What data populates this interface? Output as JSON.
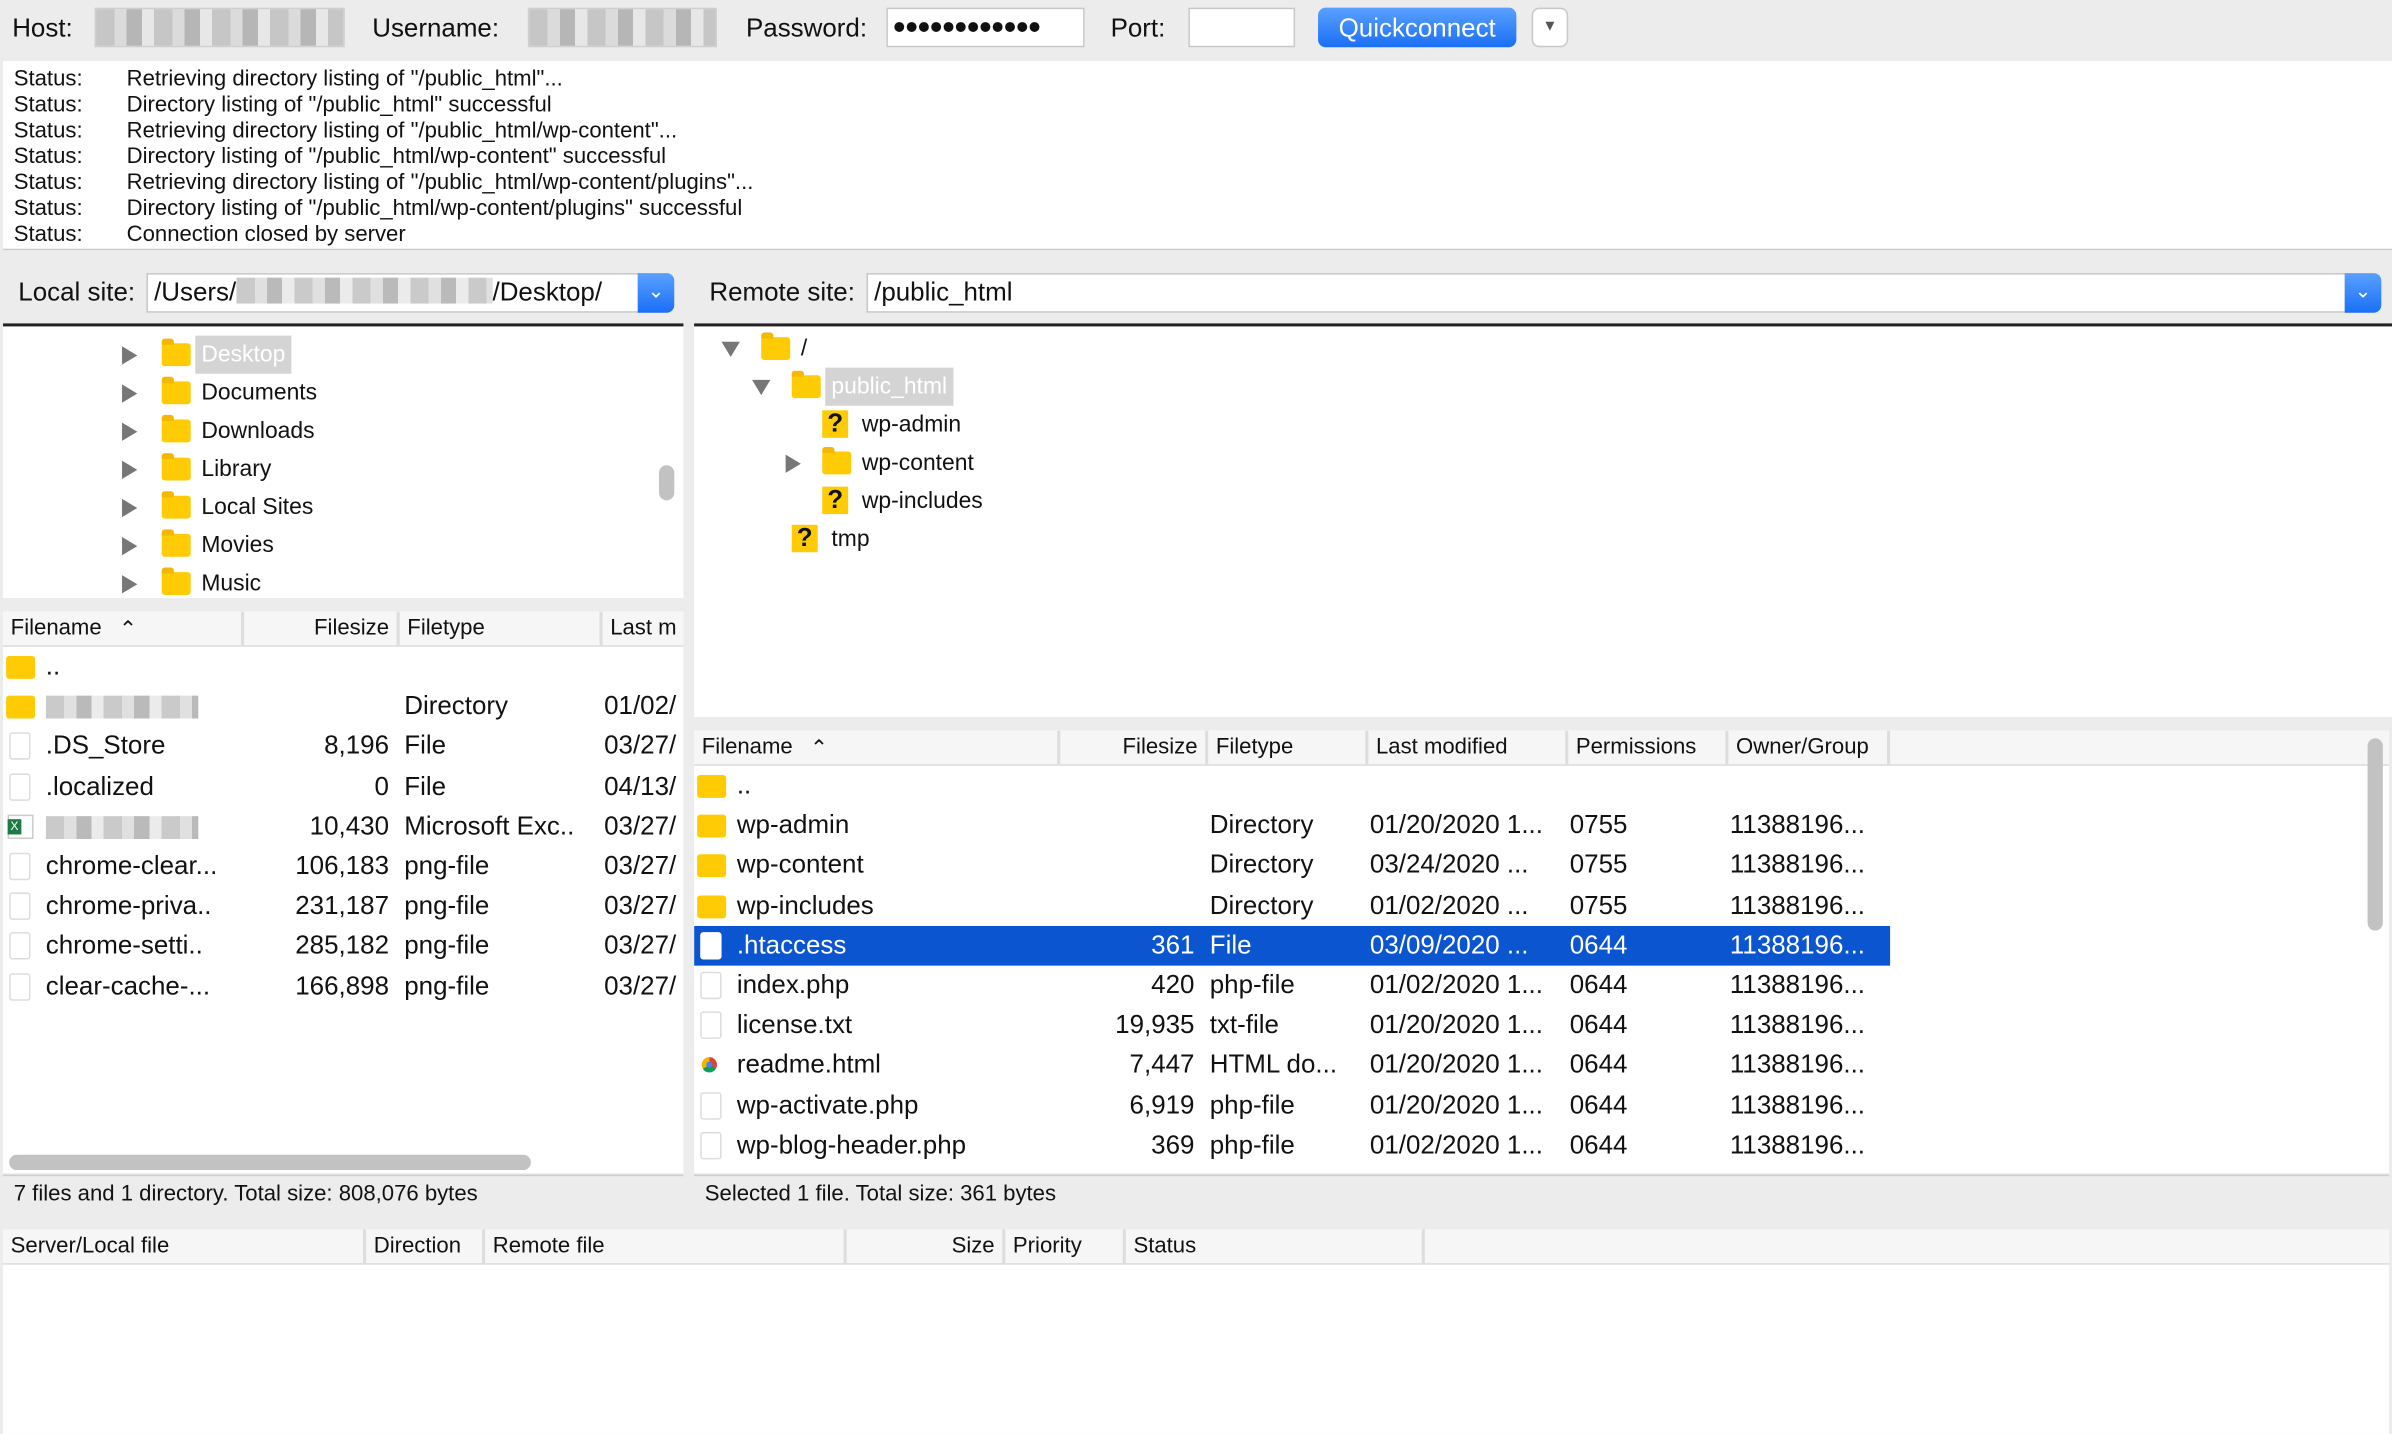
{
  "toolbar": {
    "host_label": "Host:",
    "username_label": "Username:",
    "password_label": "Password:",
    "password_value": "●●●●●●●●●●●●",
    "port_label": "Port:",
    "port_value": "",
    "quickconnect_label": "Quickconnect",
    "dropdown_icon": "chevron-down-icon"
  },
  "log": [
    {
      "key": "Status:",
      "msg": "Retrieving directory listing of \"/public_html\"..."
    },
    {
      "key": "Status:",
      "msg": "Directory listing of \"/public_html\" successful"
    },
    {
      "key": "Status:",
      "msg": "Retrieving directory listing of \"/public_html/wp-content\"..."
    },
    {
      "key": "Status:",
      "msg": "Directory listing of \"/public_html/wp-content\" successful"
    },
    {
      "key": "Status:",
      "msg": "Retrieving directory listing of \"/public_html/wp-content/plugins\"..."
    },
    {
      "key": "Status:",
      "msg": "Directory listing of \"/public_html/wp-content/plugins\" successful"
    },
    {
      "key": "Status:",
      "msg": "Connection closed by server"
    }
  ],
  "local": {
    "site_label": "Local site:",
    "path_prefix": "/Users/",
    "path_suffix": "/Desktop/",
    "tree": [
      {
        "label": "Desktop",
        "selected": true,
        "expandable": true
      },
      {
        "label": "Documents",
        "expandable": true
      },
      {
        "label": "Downloads",
        "expandable": true
      },
      {
        "label": "Library",
        "expandable": true
      },
      {
        "label": "Local Sites",
        "expandable": true
      },
      {
        "label": "Movies",
        "expandable": true
      },
      {
        "label": "Music",
        "expandable": true
      }
    ],
    "columns": [
      "Filename",
      "Filesize",
      "Filetype",
      "Last m"
    ],
    "files": [
      {
        "icon": "folder",
        "name": "..",
        "size": "",
        "type": "",
        "modified": ""
      },
      {
        "icon": "folder",
        "name": "",
        "redacted": true,
        "size": "",
        "type": "Directory",
        "modified": "01/02/"
      },
      {
        "icon": "file",
        "name": ".DS_Store",
        "size": "8,196",
        "type": "File",
        "modified": "03/27/"
      },
      {
        "icon": "file",
        "name": ".localized",
        "size": "0",
        "type": "File",
        "modified": "04/13/"
      },
      {
        "icon": "excel",
        "name": "",
        "redacted": true,
        "size": "10,430",
        "type": "Microsoft Exc..",
        "modified": "03/27/"
      },
      {
        "icon": "file",
        "name": "chrome-clear...",
        "size": "106,183",
        "type": "png-file",
        "modified": "03/27/"
      },
      {
        "icon": "file",
        "name": "chrome-priva..",
        "size": "231,187",
        "type": "png-file",
        "modified": "03/27/"
      },
      {
        "icon": "file",
        "name": "chrome-setti..",
        "size": "285,182",
        "type": "png-file",
        "modified": "03/27/"
      },
      {
        "icon": "file",
        "name": "clear-cache-...",
        "size": "166,898",
        "type": "png-file",
        "modified": "03/27/"
      }
    ],
    "status": "7 files and 1 directory. Total size: 808,076 bytes"
  },
  "remote": {
    "site_label": "Remote site:",
    "path": "/public_html",
    "tree": [
      {
        "label": "/",
        "level": 0,
        "icon": "folder",
        "expanded": true
      },
      {
        "label": "public_html",
        "level": 1,
        "icon": "folder",
        "expanded": true,
        "selected": true
      },
      {
        "label": "wp-admin",
        "level": 2,
        "icon": "question-folder"
      },
      {
        "label": "wp-content",
        "level": 2,
        "icon": "folder",
        "expandable": true
      },
      {
        "label": "wp-includes",
        "level": 2,
        "icon": "question-folder"
      },
      {
        "label": "tmp",
        "level": 1,
        "icon": "question-folder"
      }
    ],
    "columns": [
      "Filename",
      "Filesize",
      "Filetype",
      "Last modified",
      "Permissions",
      "Owner/Group"
    ],
    "files": [
      {
        "icon": "folder",
        "name": "..",
        "size": "",
        "type": "",
        "modified": "",
        "perms": "",
        "owner": ""
      },
      {
        "icon": "folder",
        "name": "wp-admin",
        "size": "",
        "type": "Directory",
        "modified": "01/20/2020 1...",
        "perms": "0755",
        "owner": "11388196..."
      },
      {
        "icon": "folder",
        "name": "wp-content",
        "size": "",
        "type": "Directory",
        "modified": "03/24/2020 ...",
        "perms": "0755",
        "owner": "11388196..."
      },
      {
        "icon": "folder",
        "name": "wp-includes",
        "size": "",
        "type": "Directory",
        "modified": "01/02/2020 ...",
        "perms": "0755",
        "owner": "11388196..."
      },
      {
        "icon": "file",
        "name": ".htaccess",
        "size": "361",
        "type": "File",
        "modified": "03/09/2020 ...",
        "perms": "0644",
        "owner": "11388196...",
        "selected": true
      },
      {
        "icon": "file",
        "name": "index.php",
        "size": "420",
        "type": "php-file",
        "modified": "01/02/2020 1...",
        "perms": "0644",
        "owner": "11388196..."
      },
      {
        "icon": "file",
        "name": "license.txt",
        "size": "19,935",
        "type": "txt-file",
        "modified": "01/20/2020 1...",
        "perms": "0644",
        "owner": "11388196..."
      },
      {
        "icon": "chrome",
        "name": "readme.html",
        "size": "7,447",
        "type": "HTML do...",
        "modified": "01/20/2020 1...",
        "perms": "0644",
        "owner": "11388196..."
      },
      {
        "icon": "file",
        "name": "wp-activate.php",
        "size": "6,919",
        "type": "php-file",
        "modified": "01/20/2020 1...",
        "perms": "0644",
        "owner": "11388196..."
      },
      {
        "icon": "file",
        "name": "wp-blog-header.php",
        "size": "369",
        "type": "php-file",
        "modified": "01/02/2020 1...",
        "perms": "0644",
        "owner": "11388196..."
      }
    ],
    "status": "Selected 1 file. Total size: 361 bytes"
  },
  "queue": {
    "columns": [
      "Server/Local file",
      "Direction",
      "Remote file",
      "Size",
      "Priority",
      "Status"
    ]
  },
  "colors": {
    "accent": "#1a6ff5",
    "selection": "#0b55d0",
    "folder": "#ffcb05"
  }
}
